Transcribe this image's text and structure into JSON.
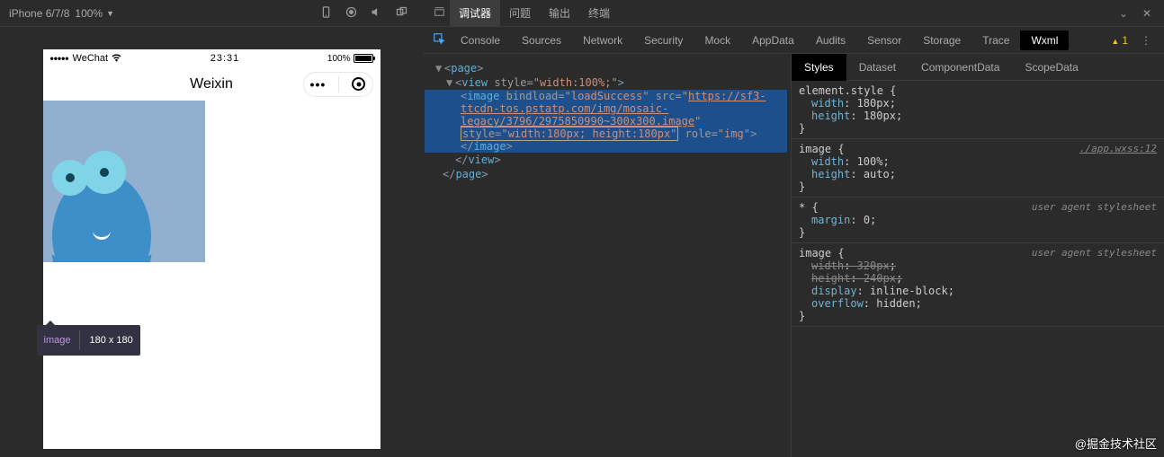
{
  "left_toolbar": {
    "device": "iPhone 6/7/8",
    "zoom": "100%"
  },
  "phone": {
    "status": {
      "carrier": "WeChat",
      "time": "23:31",
      "battery_pct": "100%"
    },
    "nav": {
      "title": "Weixin"
    },
    "tooltip": {
      "tag": "image",
      "dims": "180 x 180"
    }
  },
  "debugger": {
    "top_tabs": [
      "调试器",
      "问题",
      "输出",
      "终端"
    ],
    "top_active": 0,
    "sub_tabs": [
      "Console",
      "Sources",
      "Network",
      "Security",
      "Mock",
      "AppData",
      "Audits",
      "Sensor",
      "Storage",
      "Trace",
      "Wxml"
    ],
    "sub_active": 10,
    "warning_count": "1"
  },
  "dom": {
    "l0_open": "page",
    "l1_open_tag": "view",
    "l1_open_attr_name": "style",
    "l1_open_attr_val": "width:100%;",
    "sel_tag": "image",
    "sel_a1n": "bindload",
    "sel_a1v": "loadSuccess",
    "sel_a2n": "src",
    "sel_a2v": "https://sf3-ttcdn-tos.pstatp.com/img/mosaic-legacy/3796/2975850990~300x300.image",
    "sel_a3n": "style",
    "sel_a3v": "width:180px; height:180px",
    "sel_a4n": "role",
    "sel_a4v": "img",
    "sel_close": "image",
    "l1_close": "view",
    "l0_close": "page"
  },
  "styles": {
    "tabs": [
      "Styles",
      "Dataset",
      "ComponentData",
      "ScopeData"
    ],
    "active": 0,
    "rules": [
      {
        "selector": "element.style",
        "origin": "",
        "props": [
          {
            "name": "width",
            "value": "180px",
            "struck": false
          },
          {
            "name": "height",
            "value": "180px",
            "struck": false
          }
        ]
      },
      {
        "selector": "image",
        "origin": "./app.wxss:12",
        "origin_link": true,
        "props": [
          {
            "name": "width",
            "value": "100%",
            "struck": false
          },
          {
            "name": "height",
            "value": "auto",
            "struck": false
          }
        ]
      },
      {
        "selector": "*",
        "origin": "user agent stylesheet",
        "props": [
          {
            "name": "margin",
            "value": "0",
            "struck": false
          }
        ]
      },
      {
        "selector": "image",
        "origin": "user agent stylesheet",
        "props": [
          {
            "name": "width",
            "value": "320px",
            "struck": true
          },
          {
            "name": "height",
            "value": "240px",
            "struck": true
          },
          {
            "name": "display",
            "value": "inline-block",
            "struck": false
          },
          {
            "name": "overflow",
            "value": "hidden",
            "struck": false
          }
        ]
      }
    ]
  },
  "watermark": "@掘金技术社区"
}
